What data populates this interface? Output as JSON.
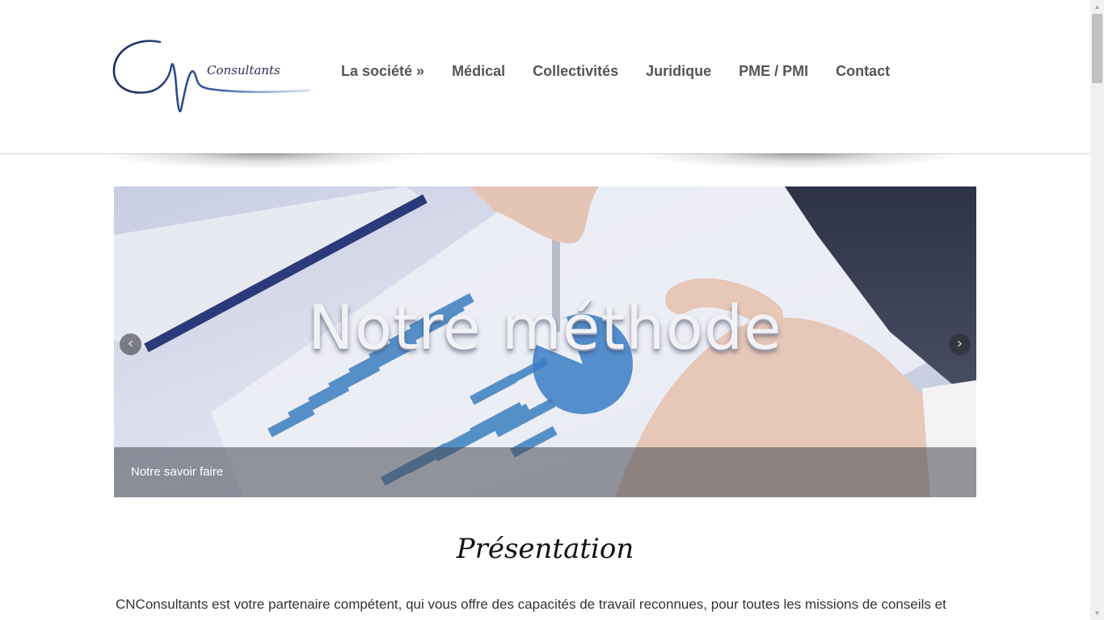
{
  "header": {
    "logo_text": "Consultants",
    "nav": [
      {
        "label": "La société »"
      },
      {
        "label": "Médical"
      },
      {
        "label": "Collectivités"
      },
      {
        "label": "Juridique"
      },
      {
        "label": "PME / PMI"
      },
      {
        "label": "Contact"
      }
    ]
  },
  "slider": {
    "headline": "Notre méthode",
    "caption": "Notre savoir faire",
    "prev_icon": "chevron-left-icon",
    "next_icon": "chevron-right-icon"
  },
  "content": {
    "title": "Présentation",
    "intro": "CNConsultants est votre partenaire compétent, qui vous offre des capacités de travail reconnues, pour toutes les missions de conseils et"
  },
  "colors": {
    "nav_text": "#555555",
    "logo_blue": "#2a3a7a",
    "caption_bar": "#464852"
  }
}
